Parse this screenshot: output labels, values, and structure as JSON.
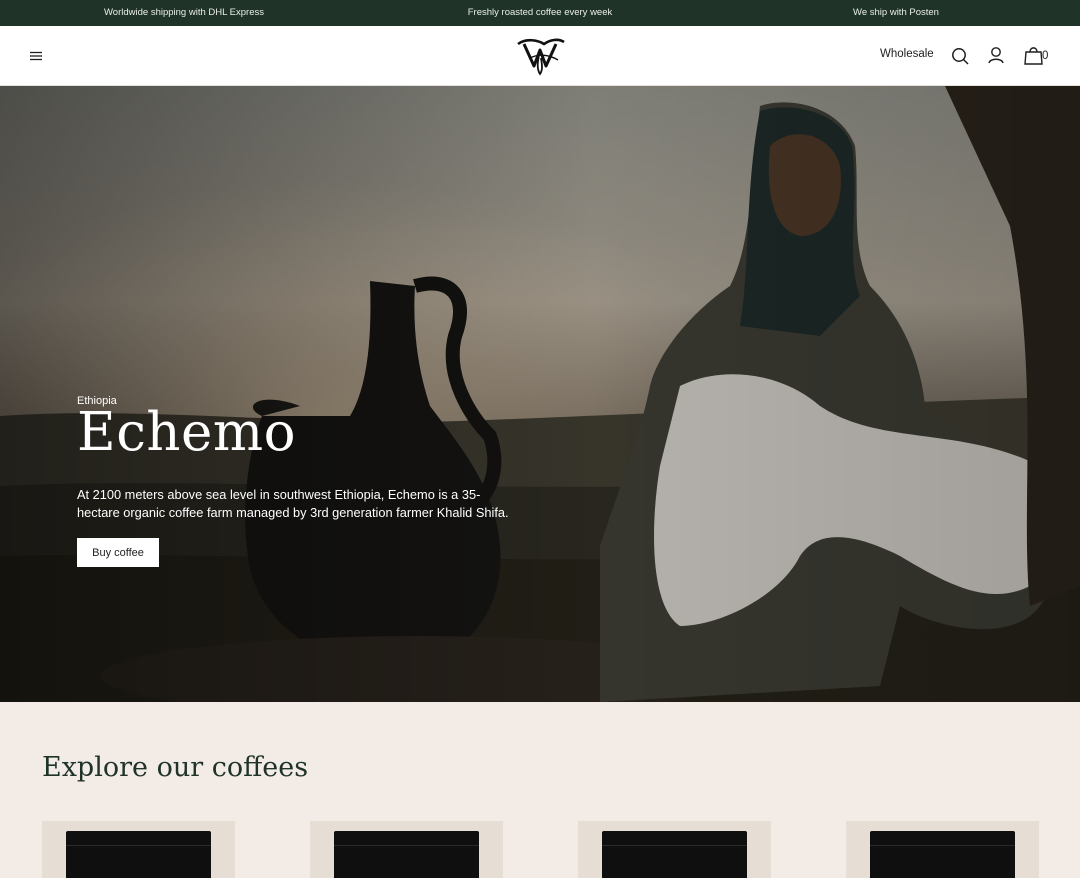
{
  "announcement": {
    "items": [
      "Worldwide shipping with DHL Express",
      "Freshly roasted coffee every week",
      "We ship with Posten"
    ]
  },
  "header": {
    "menu_icon": "hamburger-menu-icon",
    "logo_icon": "brand-monogram-logo",
    "wholesale_label": "Wholesale",
    "search_icon": "search-icon",
    "account_icon": "user-icon",
    "cart_icon": "shopping-bag-icon",
    "cart_count": "0"
  },
  "hero": {
    "eyebrow": "Ethiopia",
    "title": "Echemo",
    "description": "At 2100 meters above sea level in southwest Ethiopia, Echemo is a 35-hectare organic coffee farm managed by 3rd generation farmer Khalid Shifa.",
    "cta_label": "Buy coffee"
  },
  "explore": {
    "title": "Explore our coffees",
    "products": [
      {
        "image": "coffee-bag-image"
      },
      {
        "image": "coffee-bag-image"
      },
      {
        "image": "coffee-bag-image"
      },
      {
        "image": "coffee-bag-image"
      }
    ]
  },
  "colors": {
    "announcement_bg": "#1f3329",
    "page_bg": "#f3ece6",
    "heading": "#1f3329"
  }
}
